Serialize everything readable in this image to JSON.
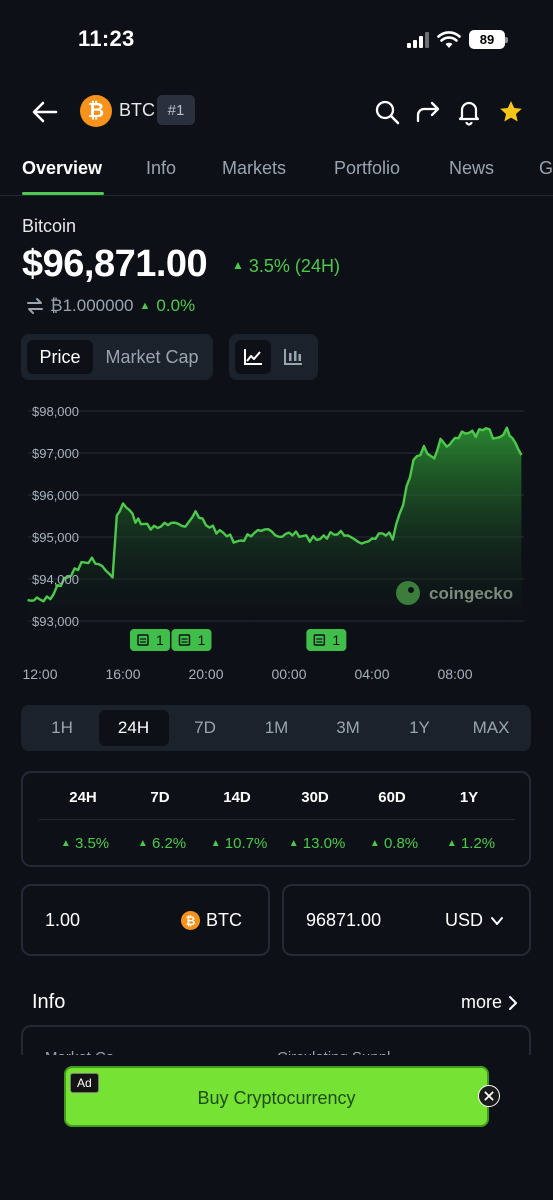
{
  "status": {
    "time": "11:23",
    "battery": "89"
  },
  "header": {
    "symbol": "BTC",
    "rank": "#1",
    "logo_glyph": "₿"
  },
  "tabs": [
    "Overview",
    "Info",
    "Markets",
    "Portfolio",
    "News",
    "G"
  ],
  "coin": {
    "name": "Bitcoin",
    "price": "$96,871.00",
    "change_24h": "3.5% (24H)",
    "btc_price": "₿1.000000",
    "btc_change": "0.0%"
  },
  "chart_toggle": {
    "price": "Price",
    "market_cap": "Market Cap"
  },
  "chart_data": {
    "type": "area",
    "y_ticks": [
      "$98,000",
      "$97,000",
      "$96,000",
      "$95,000",
      "$94,000",
      "$93,000"
    ],
    "x_ticks": [
      "12:00",
      "16:00",
      "20:00",
      "00:00",
      "04:00",
      "08:00"
    ],
    "ylim": [
      93000,
      98000
    ],
    "grid": true,
    "watermark": "coingecko",
    "color": "#4cc94b",
    "x_hours": [
      0,
      0.5,
      1,
      1.5,
      2,
      2.5,
      3,
      3.5,
      3.7,
      4,
      4.3,
      4.6,
      5,
      5.5,
      6,
      6.5,
      7,
      7.5,
      8,
      8.5,
      9,
      9.5,
      10,
      10.5,
      11,
      11.5,
      12,
      12.5,
      13,
      13.5,
      14,
      14.5,
      15,
      15.5,
      16,
      16.5,
      17,
      17.5,
      18,
      18.5,
      19,
      19.3,
      19.6,
      20,
      20.5,
      21,
      21.5,
      22,
      22.5,
      22.9,
      23.2
    ],
    "values": [
      93500,
      93550,
      93900,
      94100,
      94350,
      94450,
      94300,
      94050,
      95500,
      95800,
      95700,
      95400,
      95300,
      95200,
      95300,
      95350,
      95250,
      95600,
      95300,
      95150,
      95050,
      94850,
      95000,
      95150,
      95200,
      95000,
      95100,
      95050,
      94950,
      94950,
      95050,
      95100,
      95000,
      94850,
      94950,
      95100,
      95000,
      95800,
      96800,
      97100,
      96850,
      97350,
      97150,
      97350,
      97500,
      97450,
      97600,
      97300,
      97550,
      97250,
      96950
    ],
    "news_markers": [
      {
        "hour": 5.3,
        "count": "1"
      },
      {
        "hour": 7.3,
        "count": "1"
      },
      {
        "hour": 13.8,
        "count": "1"
      }
    ]
  },
  "periods": [
    "1H",
    "24H",
    "7D",
    "1M",
    "3M",
    "1Y",
    "MAX"
  ],
  "active_period": "24H",
  "stats": {
    "headers": [
      "24H",
      "7D",
      "14D",
      "30D",
      "60D",
      "1Y"
    ],
    "values": [
      "3.5%",
      "6.2%",
      "10.7%",
      "13.0%",
      "0.8%",
      "1.2%"
    ]
  },
  "converter": {
    "amount": "1.00",
    "from": "BTC",
    "result": "96871.00",
    "to": "USD"
  },
  "info": {
    "title": "Info",
    "more": "more",
    "col1": "Market Ca",
    "col2": "Circulating Suppl"
  },
  "ad": {
    "label": "Ad",
    "text": "Buy Cryptocurrency"
  }
}
